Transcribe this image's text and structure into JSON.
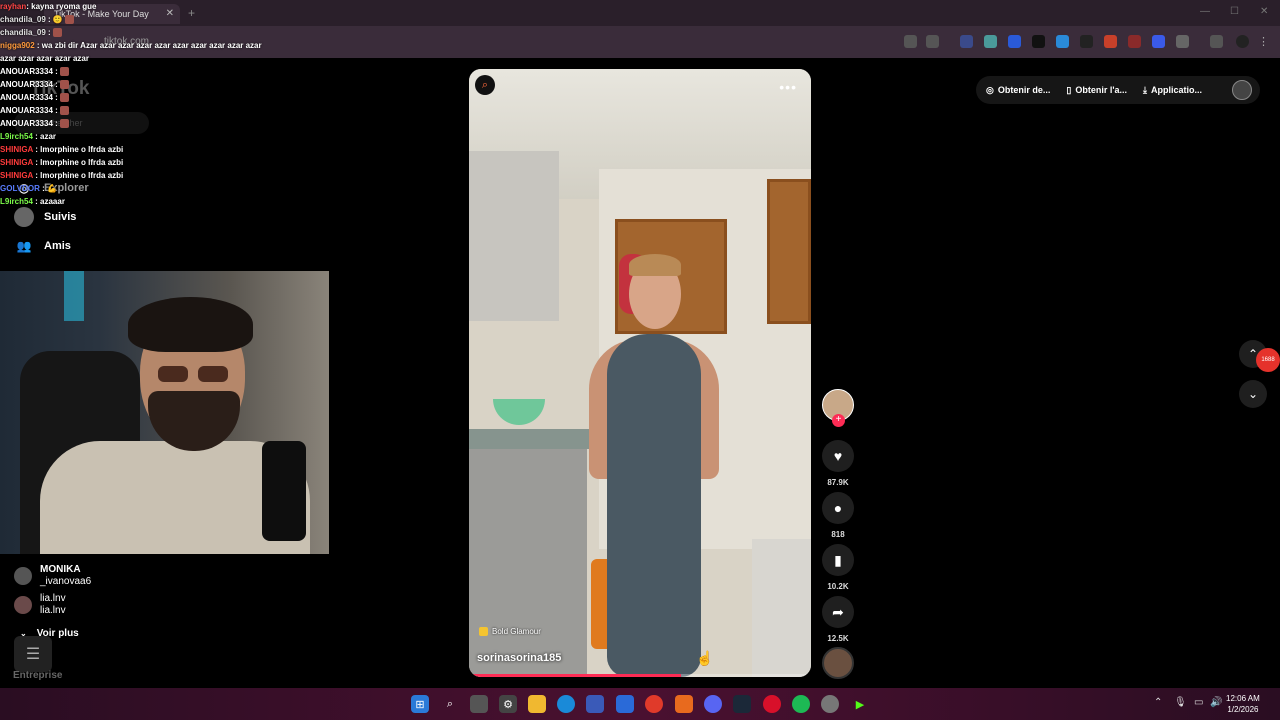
{
  "browser": {
    "tab_title": "TikTok - Make Your Day",
    "tab_close": "✕",
    "new_tab": "+",
    "url_placeholder": "tiktok.com"
  },
  "chat": [
    {
      "name": "rayhan",
      "name_color": "#ff4545",
      "msg": ": kayna ryoma gue"
    },
    {
      "name": "chandila_09",
      "name_color": "#e0e0e0",
      "msg": " : 🙂 ",
      "emote": true
    },
    {
      "name": "chandila_09",
      "name_color": "#e0e0e0",
      "msg": " : ",
      "emote": true
    },
    {
      "name": "nigga902",
      "name_color": "#ff9a3c",
      "msg": " : wa zbi dir Azar azar azar azar azar azar azar azar azar azar azar azar azar azar azar"
    },
    {
      "name": "ANOUAR3334",
      "name_color": "#ffffff",
      "msg": " : ",
      "emote": true
    },
    {
      "name": "ANOUAR3334",
      "name_color": "#ffffff",
      "msg": " : ",
      "emote": true
    },
    {
      "name": "ANOUAR3334",
      "name_color": "#ffffff",
      "msg": " : ",
      "emote": true
    },
    {
      "name": "ANOUAR3334",
      "name_color": "#ffffff",
      "msg": " : ",
      "emote": true
    },
    {
      "name": "ANOUAR3334",
      "name_color": "#ffffff",
      "msg": " : ",
      "emote": true
    },
    {
      "name": "L9irch54",
      "name_color": "#7cfc4a",
      "msg": " : azar"
    },
    {
      "name": "SHINIGA",
      "name_color": "#ff3b3b",
      "msg": " : lmorphine o lfrda azbi"
    },
    {
      "name": "SHINIGA",
      "name_color": "#ff3b3b",
      "msg": " : lmorphine o lfrda azbi"
    },
    {
      "name": "SHINIGA",
      "name_color": "#ff3b3b",
      "msg": " : lmorphine o lfrda azbi"
    },
    {
      "name": "GOLVDOR",
      "name_color": "#5a7dff",
      "msg": " : 💪"
    },
    {
      "name": "L9irch54",
      "name_color": "#7cfc4a",
      "msg": " : azaaar"
    }
  ],
  "tiktok": {
    "logo": "TikTok",
    "search_placeholder": "Rechercher",
    "nav": {
      "explorer": "Explorer",
      "suivis": "Suivis",
      "amis": "Amis"
    },
    "suggested": [
      {
        "name": "MONIKA",
        "handle": "_ivanovaa6"
      },
      {
        "name": "lia.lnv",
        "handle": "lia.lnv"
      }
    ],
    "voir_plus": "Voir plus",
    "entreprise": "Entreprise",
    "top_actions": [
      "Obtenir de...",
      "Obtenir l'a...",
      "Applicatio..."
    ],
    "video": {
      "username": "sorinasorina185",
      "effect": "Bold Glamour",
      "progress": 0.62,
      "more": "•••"
    },
    "actions": {
      "likes": "87.9K",
      "comments": "818",
      "saves": "10.2K",
      "shares": "12.5K"
    }
  },
  "taskbar": {
    "time": "12:06 AM",
    "date": "1/2/2026"
  },
  "colors": {
    "accent": "#fe2c55",
    "taskbar": "#4a1030"
  }
}
